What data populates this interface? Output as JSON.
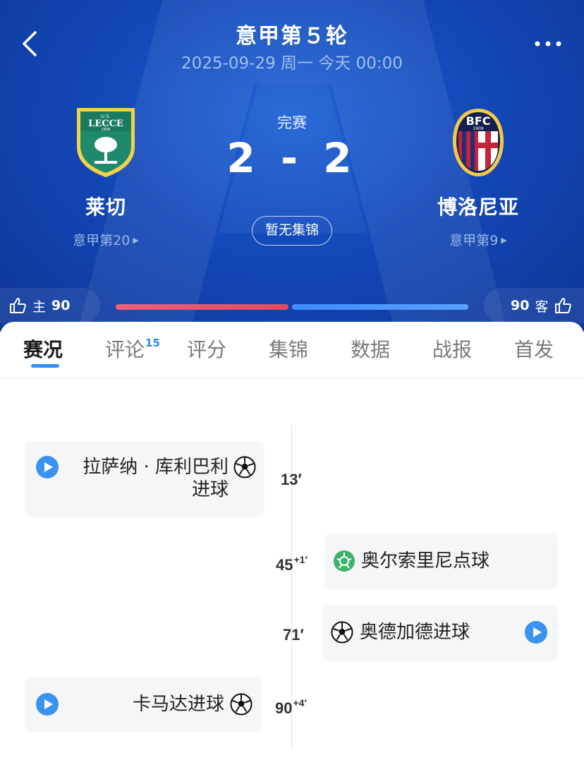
{
  "header": {
    "title": "意甲第５轮",
    "subtitle": "2025-09-29 周一 今天 00:00",
    "back_icon": "chevron-left-icon",
    "more_icon": "more-dots-icon"
  },
  "match": {
    "status": "完赛",
    "score": "2 - 2",
    "highlight_label": "暂无集锦",
    "home": {
      "name": "莱切",
      "rank": "意甲第20",
      "logo": "lecce-logo",
      "logo_text": "U.S. LECCE 1908"
    },
    "away": {
      "name": "博洛尼亚",
      "rank": "意甲第9",
      "logo": "bologna-logo",
      "logo_text": "BFC 1909"
    }
  },
  "votes": {
    "home_label": "主",
    "home_count": "90",
    "away_label": "客",
    "away_count": "90",
    "home_share": 0.5,
    "icon": "thumbs-up-icon",
    "colors": {
      "home": "#e24a63",
      "away": "#3f8cff"
    }
  },
  "tabs": [
    {
      "label": "赛况",
      "badge": "",
      "active": true
    },
    {
      "label": "评论",
      "badge": "15",
      "active": false
    },
    {
      "label": "评分",
      "badge": "",
      "active": false
    },
    {
      "label": "集锦",
      "badge": "",
      "active": false
    },
    {
      "label": "数据",
      "badge": "",
      "active": false
    },
    {
      "label": "战报",
      "badge": "",
      "active": false
    },
    {
      "label": "首发",
      "badge": "",
      "active": false
    }
  ],
  "events": [
    {
      "side": "home",
      "minute": "13′",
      "extra": "",
      "line1": "拉萨纳 · 库利巴利",
      "line2": "进球",
      "type": "goal",
      "has_video": true
    },
    {
      "side": "away",
      "minute": "45",
      "extra": "+1′",
      "line1": "奥尔索里尼点球",
      "type": "penalty",
      "has_video": false
    },
    {
      "side": "away",
      "minute": "71′",
      "extra": "",
      "line1": "奥德加德进球",
      "type": "goal",
      "has_video": true
    },
    {
      "side": "home",
      "minute": "90",
      "extra": "+4′",
      "line1": "卡马达进球",
      "type": "goal",
      "has_video": true
    }
  ],
  "colors": {
    "accent": "#2f8cff",
    "header_bg": "#1348b8",
    "penalty": "#3fb36a"
  }
}
